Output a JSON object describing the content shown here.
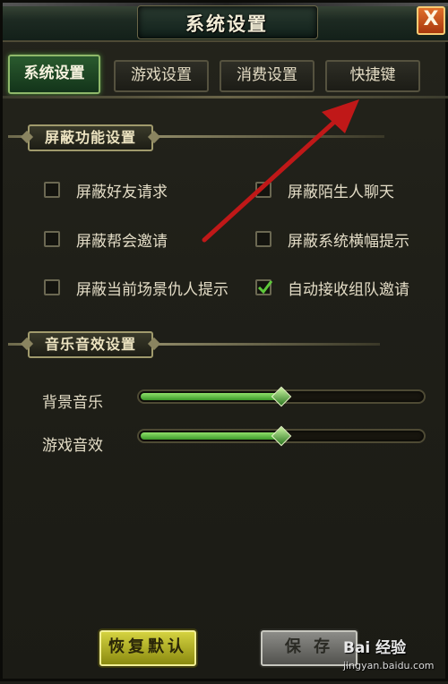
{
  "window": {
    "title": "系统设置",
    "close_symbol": "X"
  },
  "tabs": [
    {
      "label": "系统设置",
      "active": true
    },
    {
      "label": "游戏设置",
      "active": false
    },
    {
      "label": "消费设置",
      "active": false
    },
    {
      "label": "快捷键",
      "active": false
    }
  ],
  "shield_section": {
    "title": "屏蔽功能设置",
    "options": [
      {
        "label": "屏蔽好友请求",
        "checked": false
      },
      {
        "label": "屏蔽陌生人聊天",
        "checked": false
      },
      {
        "label": "屏蔽帮会邀请",
        "checked": false
      },
      {
        "label": "屏蔽系统横幅提示",
        "checked": false
      },
      {
        "label": "屏蔽当前场景仇人提示",
        "checked": false
      },
      {
        "label": "自动接收组队邀请",
        "checked": true
      }
    ]
  },
  "audio_section": {
    "title": "音乐音效设置",
    "sliders": [
      {
        "label": "背景音乐",
        "level": 0.5
      },
      {
        "label": "游戏音效",
        "level": 0.5
      }
    ]
  },
  "buttons": {
    "reset": "恢复默认",
    "save": "保 存"
  },
  "watermark": {
    "text": "Bai 经验",
    "url": "jingyan.baidu.com"
  },
  "colors": {
    "accent_green": "#3d9a2a",
    "annotation_arrow": "#c01818",
    "reset_button": "#d4d240"
  }
}
